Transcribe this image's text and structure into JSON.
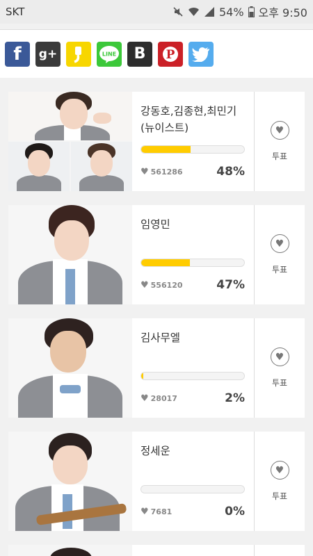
{
  "status_bar": {
    "carrier": "SKT",
    "battery": "54%",
    "time": "오후 9:50",
    "icons": [
      "mute-icon",
      "wifi-icon",
      "signal-icon",
      "battery-icon"
    ]
  },
  "share": [
    {
      "name": "facebook-share-icon",
      "glyph": "f"
    },
    {
      "name": "google-plus-share-icon",
      "glyph": "g+"
    },
    {
      "name": "kakaostory-share-icon",
      "glyph": ""
    },
    {
      "name": "line-share-icon",
      "glyph": "LINE"
    },
    {
      "name": "band-share-icon",
      "glyph": "B"
    },
    {
      "name": "pinterest-share-icon",
      "glyph": "P"
    },
    {
      "name": "twitter-share-icon",
      "glyph": ""
    }
  ],
  "colors": {
    "bar_fill": "#ffcc00",
    "facebook": "#3b5998",
    "kakao": "#f7d600",
    "line": "#3cc83a",
    "pinterest": "#cb2027",
    "twitter": "#55acee"
  },
  "candidates": [
    {
      "name": "강동호,김종현,최민기\n(뉴이스트)",
      "votes": "561286",
      "percent": "48%",
      "fill": 0.48,
      "vote_label": "투표"
    },
    {
      "name": "임영민",
      "votes": "556120",
      "percent": "47%",
      "fill": 0.47,
      "vote_label": "투표"
    },
    {
      "name": "김사무엘",
      "votes": "28017",
      "percent": "2%",
      "fill": 0.02,
      "vote_label": "투표"
    },
    {
      "name": "정세운",
      "votes": "7681",
      "percent": "0%",
      "fill": 0.0,
      "vote_label": "투표"
    }
  ]
}
